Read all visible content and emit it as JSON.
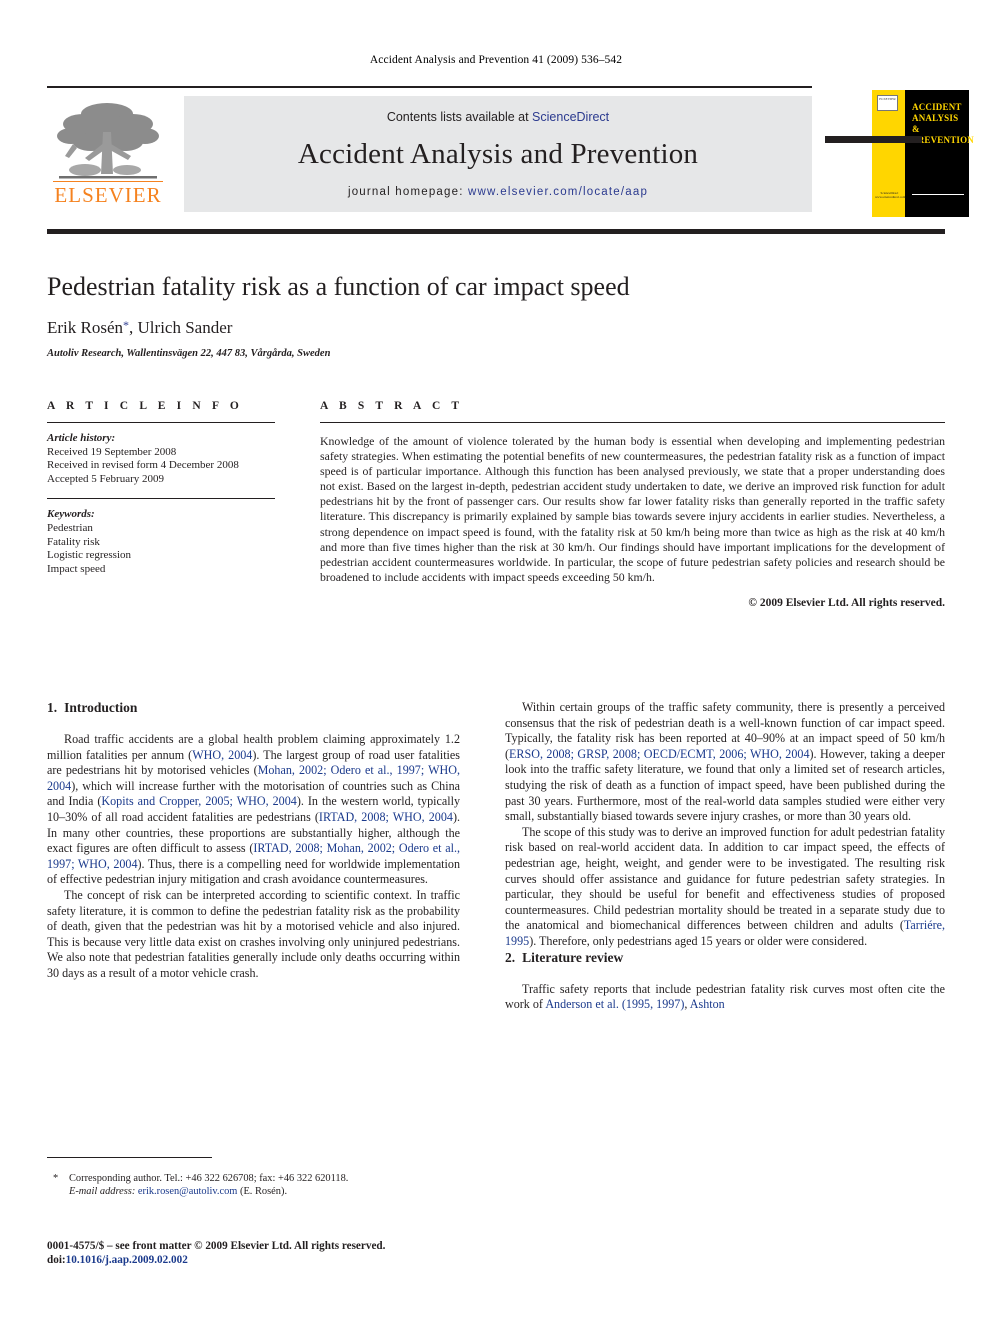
{
  "running_head": "Accident Analysis and Prevention 41 (2009) 536–542",
  "masthead": {
    "publisher_name": "ELSEVIER",
    "publisher_logo_icon": "elsevier-tree-icon",
    "contents_prefix": "Contents lists available at ",
    "contents_link": "ScienceDirect",
    "journal_title": "Accident Analysis and Prevention",
    "homepage_prefix": "journal  homepage: ",
    "homepage_url": "www.elsevier.com/locate/aap",
    "cover": {
      "title_line1": "ACCIDENT",
      "title_line2": "ANALYSIS",
      "title_line3": "&",
      "title_line4": "PREVENTION",
      "els_badge": "ELSEVIER",
      "sd_badge": "ScienceDirect",
      "sd_url": "www.sciencedirect.com",
      "yellow": "#FFD600",
      "black": "#000000"
    }
  },
  "article": {
    "title": "Pedestrian fatality risk as a function of car impact speed",
    "authors": "Erik Rosén",
    "corresponding_marker": "*",
    "authors_rest": ", Ulrich Sander",
    "affiliation": "Autoliv Research, Wallentinsvägen 22, 447 83, Vårgårda, Sweden"
  },
  "article_info": {
    "heading": "A R T I C L E    I N F O",
    "history_label": "Article history:",
    "history": [
      "Received 19 September 2008",
      "Received in revised form 4 December 2008",
      "Accepted 5 February 2009"
    ],
    "keywords_label": "Keywords:",
    "keywords": [
      "Pedestrian",
      "Fatality risk",
      "Logistic regression",
      "Impact speed"
    ]
  },
  "abstract": {
    "heading": "A B S T R A C T",
    "text": "Knowledge of the amount of violence tolerated by the human body is essential when developing and implementing pedestrian safety strategies. When estimating the potential benefits of new countermeasures, the pedestrian fatality risk as a function of impact speed is of particular importance. Although this function has been analysed previously, we state that a proper understanding does not exist. Based on the largest in-depth, pedestrian accident study undertaken to date, we derive an improved risk function for adult pedestrians hit by the front of passenger cars. Our results show far lower fatality risks than generally reported in the traffic safety literature. This discrepancy is primarily explained by sample bias towards severe injury accidents in earlier studies. Nevertheless, a strong dependence on impact speed is found, with the fatality risk at 50 km/h being more than twice as high as the risk at 40 km/h and more than five times higher than the risk at 30 km/h. Our findings should have important implications for the development of pedestrian accident countermeasures worldwide. In particular, the scope of future pedestrian safety policies and research should be broadened to include accidents with impact speeds exceeding 50 km/h.",
    "copyright": "© 2009 Elsevier Ltd. All rights reserved."
  },
  "sections": {
    "introduction": {
      "number": "1.",
      "title": "Introduction",
      "p1_a": "Road traffic accidents are a global health problem claiming approximately 1.2 million fatalities per annum (",
      "p1_c1": "WHO, 2004",
      "p1_b": "). The largest group of road user fatalities are pedestrians hit by motorised vehicles (",
      "p1_c2": "Mohan, 2002; Odero et al., 1997; WHO, 2004",
      "p1_c": "), which will increase further with the motorisation of countries such as China and India (",
      "p1_c3": "Kopits and Cropper, 2005; WHO, 2004",
      "p1_d": "). In the western world, typically 10–30% of all road accident fatalities are pedestrians (",
      "p1_c4": "IRTAD, 2008; WHO, 2004",
      "p1_e": "). In many other countries, these proportions are substantially higher, although the exact figures are often difficult to assess (",
      "p1_c5": "IRTAD, 2008; Mohan, 2002; Odero et al., 1997; WHO, 2004",
      "p1_f": "). Thus, there is a compelling need for worldwide implementation of effective pedestrian injury mitigation and crash avoidance countermeasures.",
      "p2": "The concept of risk can be interpreted according to scientific context. In traffic safety literature, it is common to define the pedestrian fatality risk as the probability of death, given that the pedestrian was hit by a motorised vehicle and also injured. This is because very little data exist on crashes involving only uninjured pedestrians. We also note that pedestrian fatalities generally include only deaths occurring within 30 days as a result of a motor vehicle crash.",
      "p3_a": "Within certain groups of the traffic safety community, there is presently a perceived consensus that the risk of pedestrian death is a well-known function of car impact speed. Typically, the fatality risk has been reported at 40–90% at an impact speed of 50 km/h (",
      "p3_c1": "ERSO, 2008; GRSP, 2008; OECD/ECMT, 2006; WHO, 2004",
      "p3_b": "). However, taking a deeper look into the traffic safety literature, we found that only a limited set of research articles, studying the risk of death as a function of impact speed, have been published during the past 30 years. Furthermore, most of the real-world data samples studied were either very small, substantially biased towards severe injury crashes, or more than 30 years old.",
      "p4_a": "The scope of this study was to derive an improved function for adult pedestrian fatality risk based on real-world accident data. In addition to car impact speed, the effects of pedestrian age, height, weight, and gender were to be investigated. The resulting risk curves should offer assistance and guidance for future pedestrian safety strategies. In particular, they should be useful for benefit and effectiveness studies of proposed countermeasures. Child pedestrian mortality should be treated in a separate study due to the anatomical and biomechanical differences between children and adults (",
      "p4_c1": "Tarriére, 1995",
      "p4_b": "). Therefore, only pedestrians aged 15 years or older were considered."
    },
    "literature_review": {
      "number": "2.",
      "title": "Literature review",
      "p1_a": "Traffic safety reports that include pedestrian fatality risk curves most often cite the work of ",
      "p1_c1": "Anderson et al. (1995, 1997)",
      "p1_b": ", ",
      "p1_c2": "Ashton"
    }
  },
  "footer": {
    "corresponding_marker": "*",
    "corresponding_label": "Corresponding author. Tel.: +46 322 626708; fax: +46 322 620118.",
    "email_label": "E-mail address:",
    "email": "erik.rosen@autoliv.com",
    "email_owner": "(E. Rosén).",
    "imprint": "0001-4575/$ – see front matter © 2009 Elsevier Ltd. All rights reserved.",
    "doi_label": "doi:",
    "doi": "10.1016/j.aap.2009.02.002"
  }
}
